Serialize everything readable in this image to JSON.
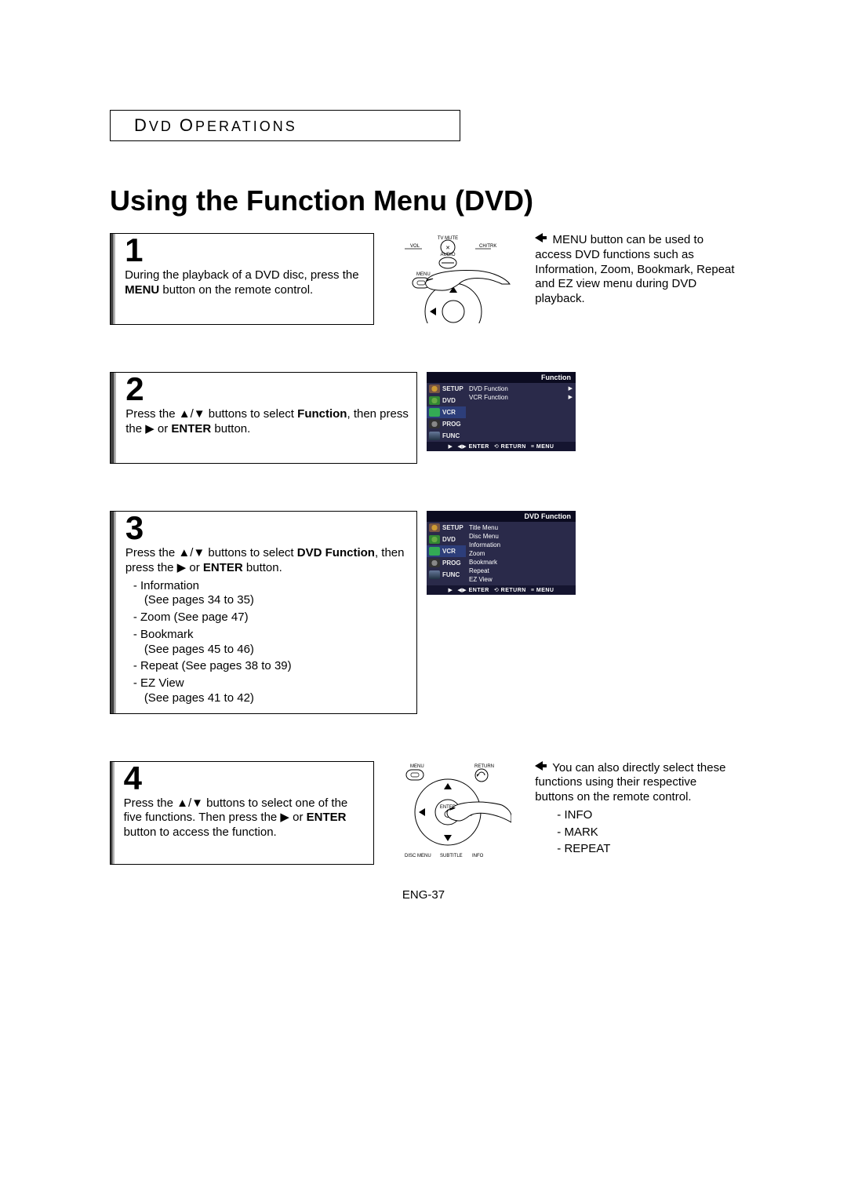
{
  "header": {
    "section": "DVD OPERATIONS"
  },
  "title": "Using the Function Menu (DVD)",
  "step1": {
    "num": "1",
    "text_a": "During the playback of a DVD disc, press the ",
    "bold": "MENU",
    "text_b": " button on the remote control.",
    "note": "MENU button can be used to access DVD functions such as Information, Zoom, Bookmark, Repeat and EZ view menu during DVD playback.",
    "remote": {
      "vol": "VOL",
      "mute": "TV MUTE",
      "chtrk": "CH/TRK",
      "audio": "AUDIO",
      "menu": "MENU"
    }
  },
  "step2": {
    "num": "2",
    "text_a": "Press the ▲/▼ buttons to select ",
    "bold": "Function",
    "text_b": ", then press the ▶ or ",
    "bold2": "ENTER",
    "text_c": " button.",
    "osd_title": "Function",
    "side": [
      "SETUP",
      "DVD",
      "VCR",
      "PROG",
      "FUNC"
    ],
    "main": [
      "DVD Function",
      "VCR Function"
    ],
    "footer": {
      "enter": "ENTER",
      "return": "RETURN",
      "menu": "MENU"
    }
  },
  "step3": {
    "num": "3",
    "text_a": "Press the ▲/▼ buttons to select ",
    "bold": "DVD Function",
    "text_b": ", then press the ▶ or ",
    "bold2": "ENTER",
    "text_c": " button.",
    "bul": [
      "Information",
      "Zoom (See page 47)",
      "Bookmark",
      "Repeat (See pages 38 to 39)",
      "EZ View"
    ],
    "bul_sub": {
      "0": "(See pages 34 to 35)",
      "2": "(See pages 45 to 46)",
      "4": "(See pages 41 to 42)"
    },
    "osd_title": "DVD Function",
    "side": [
      "SETUP",
      "DVD",
      "VCR",
      "PROG",
      "FUNC"
    ],
    "main": [
      "Title Menu",
      "Disc Menu",
      "Information",
      "Zoom",
      "Bookmark",
      "Repeat",
      "EZ View"
    ],
    "footer": {
      "enter": "ENTER",
      "return": "RETURN",
      "menu": "MENU"
    }
  },
  "step4": {
    "num": "4",
    "text_a": "Press the ▲/▼ buttons to select one of the five functions. Then press the ▶ or ",
    "bold": "ENTER",
    "text_b": " button to access the function.",
    "note_a": "You can also directly select these functions using their respective buttons on the remote control.",
    "bul": [
      "INFO",
      "MARK",
      "REPEAT"
    ],
    "remote": {
      "menu": "MENU",
      "return": "RETURN",
      "enter": "ENTER",
      "discmenu": "DISC MENU",
      "subtitle": "SUBTITLE",
      "info": "INFO"
    }
  },
  "pagenum": "ENG-37"
}
